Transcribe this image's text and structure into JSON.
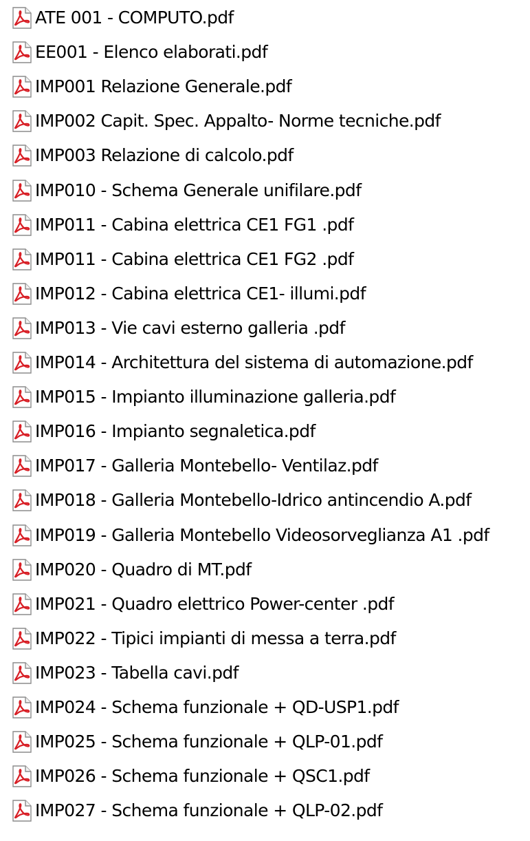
{
  "explorer": {
    "icon": "pdf-file-icon",
    "colors": {
      "text": "#000000",
      "icon_red": "#d81f26",
      "icon_page": "#ffffff",
      "icon_border": "#8c8c8c"
    },
    "files": [
      "ATE 001 - COMPUTO.pdf",
      "EE001 - Elenco elaborati.pdf",
      "IMP001 Relazione Generale.pdf",
      "IMP002 Capit. Spec. Appalto- Norme tecniche.pdf",
      "IMP003  Relazione di calcolo.pdf",
      "IMP010 - Schema Generale unifilare.pdf",
      "IMP011 - Cabina elettrica CE1 FG1 .pdf",
      "IMP011 - Cabina elettrica CE1 FG2 .pdf",
      "IMP012 - Cabina elettrica CE1- illumi.pdf",
      "IMP013 - Vie cavi esterno galleria .pdf",
      "IMP014 - Architettura del sistema di automazione.pdf",
      "IMP015 - Impianto illuminazione galleria.pdf",
      "IMP016 - Impianto segnaletica.pdf",
      "IMP017 - Galleria Montebello- Ventilaz.pdf",
      "IMP018 - Galleria Montebello-Idrico antincendio A.pdf",
      "IMP019 - Galleria Montebello Videosorveglianza A1 .pdf",
      "IMP020 - Quadro di MT.pdf",
      "IMP021 - Quadro elettrico Power-center .pdf",
      "IMP022 - Tipici impianti di messa a terra.pdf",
      "IMP023 - Tabella cavi.pdf",
      "IMP024 - Schema funzionale + QD-USP1.pdf",
      "IMP025 - Schema funzionale + QLP-01.pdf",
      "IMP026 - Schema funzionale + QSC1.pdf",
      "IMP027 - Schema funzionale + QLP-02.pdf"
    ]
  }
}
